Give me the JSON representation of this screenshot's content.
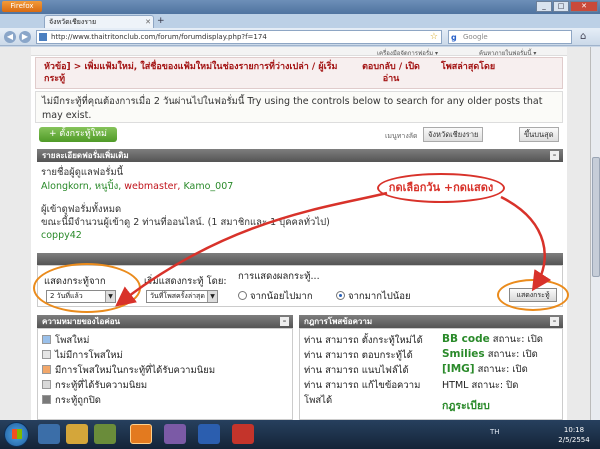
{
  "browser": {
    "app_button": "Firefox",
    "tab_title": "จังหวัดเชียงราย",
    "url": "http://www.thaitritonclub.com/forum/forumdisplay.php?f=174",
    "search_placeholder": "Google",
    "window_controls": [
      "_",
      "□",
      "✕"
    ]
  },
  "page": {
    "top_links": [
      "เครื่องมือจัดการฟอรั่ม ▾",
      "ค้นหาภายในฟอรั่มนี้ ▾"
    ],
    "column_headers": {
      "title": "หัวข้อ] > เพิ่มแฟ้มใหม่, ใส่ชื่อของแฟ้มใหม่ในช่องรายการที่ว่างเปล่า / ผู้เริ่มกระทู้",
      "replies": "ตอบกลับ / เปิดอ่าน",
      "last_post": "โพสล่าสุดโดย"
    },
    "no_posts_message": "ไม่มีกระทู้ที่คุณต้องการเมื่อ 2 วันผ่านไปในฟอรั่มนี้ Try using the controls below to search for any older posts that may exist.",
    "new_thread_button": "+ ตั้งกระทู้ใหม่",
    "tools_label": "เมนูทางลัด",
    "tool_buttons": [
      "จังหวัดเชียงราย",
      "ขึ้นบนสุด"
    ],
    "forum_info": {
      "header": "รายละเอียดฟอรั่มเพิ่มเติม",
      "viewers_label": "รายชื่อผู้ดูแลฟอรั่มนี้",
      "moderators": [
        "Alongkorn,",
        "หนูปิ้ง,",
        "webmaster,",
        "Kamo_007"
      ],
      "users_label": "ผู้เข้าดูฟอรั่มทั้งหมด",
      "users_count_line": "ขณะนี้มีจำนวนผู้เข้าดู 2 ท่านที่ออนไลน์. (1 สมาชิกและ 1 บุคคลทั่วไป)",
      "online_user": "coppy42"
    },
    "annotation_text": "กดเลือกวัน +กดแสดง",
    "search_options": {
      "header": "ตัวเลือกการแสดงผลกระทู้",
      "show_from_label": "แสดงกระทู้จาก",
      "show_from_value": "2 วันที่แล้ว",
      "sort_by_label": "เริ่มแสดงกระทู้ โดย:",
      "sort_by_value": "วันที่โพสครั้งล่าสุด",
      "order_label": "การแสดงผลกระทู้...",
      "order_options": [
        "จากน้อยไปมาก",
        "จากมากไปน้อย"
      ],
      "selected_order": "จากมากไปน้อย",
      "show_button": "แสดงกระทู้"
    },
    "legend": {
      "header": "ความหมายของไอค่อน",
      "items": [
        "โพสใหม่",
        "ไม่มีการโพสใหม่",
        "มีการโพสใหม่ในกระทู้ที่ได้รับความนิยม",
        "กระทู้ที่ได้รับความนิยม",
        "กระทู้ถูกปิด"
      ]
    },
    "rules": {
      "header": "กฎการโพสข้อความ",
      "left": [
        "ท่าน สามารถ ตั้งกระทู้ใหม่ได้",
        "ท่าน สามารถ ตอบกระทู้ได้",
        "ท่าน สามารถ แนบไฟล์ได้",
        "ท่าน สามารถ แก้ไขข้อความ",
        "โพสได้"
      ],
      "right_strong": [
        "BB code",
        "Smilies",
        "[IMG]"
      ],
      "right_status": [
        "สถานะ: เปิด",
        "สถานะ: เปิด",
        "สถานะ: เปิด"
      ],
      "html_line": "HTML สถานะ: ปิด",
      "rules_link": "กฎระเบียบ"
    }
  },
  "taskbar": {
    "language": "TH",
    "time": "10:18",
    "date": "2/5/2554"
  }
}
